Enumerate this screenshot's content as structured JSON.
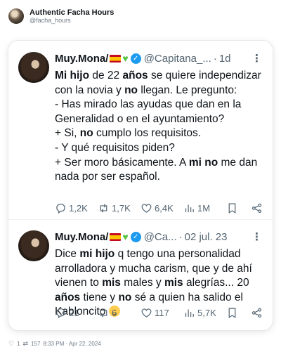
{
  "header": {
    "name": "Authentic Facha Hours",
    "handle": "@facha_hours"
  },
  "tweets": [
    {
      "display_name": "Muy.Mona/",
      "handle": "@Capitana_...",
      "time": "1d",
      "text_segments": [
        {
          "t": "Mi hijo",
          "b": true
        },
        {
          "t": " de 22 ",
          "b": false
        },
        {
          "t": "años",
          "b": true
        },
        {
          "t": " se quiere independizar con la novia y ",
          "b": false
        },
        {
          "t": "no",
          "b": true
        },
        {
          "t": " llegan. Le pregunto:",
          "b": false
        },
        {
          "br": true
        },
        {
          "t": "- Has mirado las ayudas que dan en la Generalidad o en el ayuntamiento?",
          "b": false
        },
        {
          "br": true
        },
        {
          "t": "+ Si, ",
          "b": false
        },
        {
          "t": "no",
          "b": true
        },
        {
          "t": " cumplo los requisitos.",
          "b": false
        },
        {
          "br": true
        },
        {
          "t": "- Y qué requisitos piden?",
          "b": false
        },
        {
          "br": true
        },
        {
          "t": "+ Ser moro básicamente. A ",
          "b": false
        },
        {
          "t": "mi no",
          "b": true
        },
        {
          "t": " me dan nada por ser español.",
          "b": false
        }
      ],
      "replies": "1,2K",
      "retweets": "1,7K",
      "likes": "6,4K",
      "views": "1M"
    },
    {
      "display_name": "Muy.Mona/",
      "handle": "@Ca...",
      "time": "02 jul. 23",
      "text_segments": [
        {
          "t": "Dice ",
          "b": false
        },
        {
          "t": "mi hijo",
          "b": true
        },
        {
          "t": " q tengo una personalidad arrolladora y mucha carism, que y de ahí vienen to ",
          "b": false
        },
        {
          "t": "mis",
          "b": true
        },
        {
          "t": " males y ",
          "b": false
        },
        {
          "t": "mis",
          "b": true
        },
        {
          "t": " alegrías... 20 ",
          "b": false
        },
        {
          "t": "años",
          "b": true
        },
        {
          "t": " tiene y ",
          "b": false
        },
        {
          "t": "no",
          "b": true
        },
        {
          "t": " sé a quien ha salido el Kabloncito ",
          "b": false
        },
        {
          "emoji": "smile"
        }
      ],
      "replies": "21",
      "retweets": "6",
      "likes": "117",
      "views": "5,7K"
    }
  ],
  "footer": {
    "likes": "1",
    "retweets": "157",
    "timestamp": "8:33 PM · Apr 22, 2024"
  },
  "colors": {
    "verified": "#1d9bf0",
    "muted": "#536471",
    "heart_emoji": "#5cc34a"
  }
}
